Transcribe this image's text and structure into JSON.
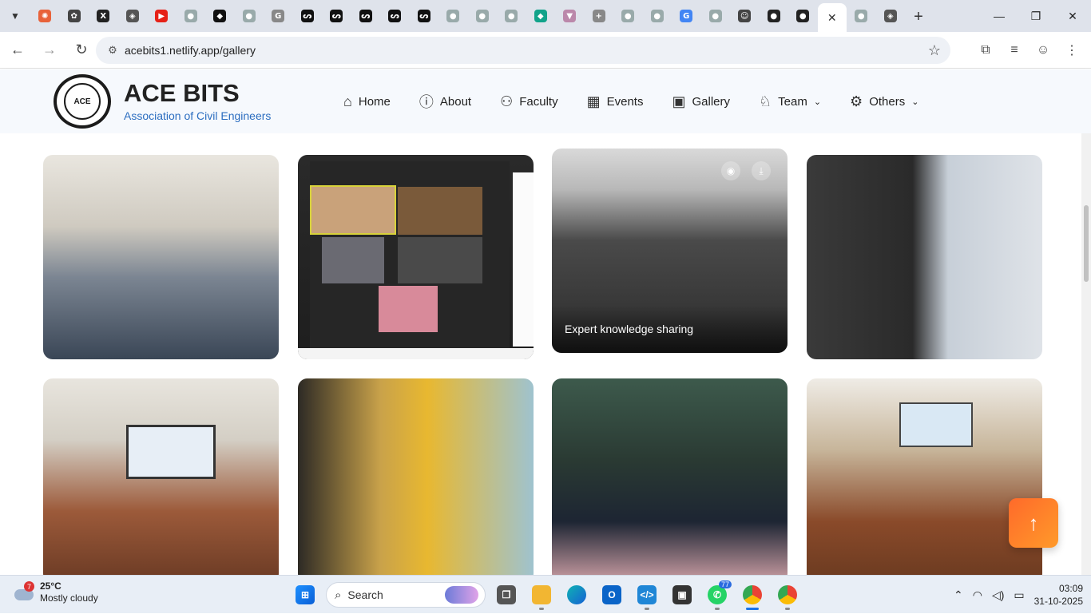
{
  "browser": {
    "tabs": [
      {
        "name": "asterisk",
        "color": "#e8623a",
        "glyph": "✺"
      },
      {
        "name": "openai",
        "color": "#444",
        "glyph": "✿"
      },
      {
        "name": "x",
        "color": "#222",
        "glyph": "X"
      },
      {
        "name": "shield",
        "color": "#555",
        "glyph": "◈"
      },
      {
        "name": "youtube",
        "color": "#e62117",
        "glyph": "▶"
      },
      {
        "name": "globe",
        "color": "#9aa",
        "glyph": "●"
      },
      {
        "name": "leaf",
        "color": "#111",
        "glyph": "◆"
      },
      {
        "name": "globe",
        "color": "#9aa",
        "glyph": "●"
      },
      {
        "name": "google",
        "color": "#888",
        "glyph": "G"
      },
      {
        "name": "snake",
        "color": "#111",
        "glyph": "ᔕ"
      },
      {
        "name": "snake",
        "color": "#111",
        "glyph": "ᔕ"
      },
      {
        "name": "snake",
        "color": "#111",
        "glyph": "ᔕ"
      },
      {
        "name": "snake",
        "color": "#111",
        "glyph": "ᔕ"
      },
      {
        "name": "snake",
        "color": "#111",
        "glyph": "ᔕ"
      },
      {
        "name": "globe",
        "color": "#9aa",
        "glyph": "●"
      },
      {
        "name": "globe",
        "color": "#9aa",
        "glyph": "●"
      },
      {
        "name": "globe",
        "color": "#9aa",
        "glyph": "●"
      },
      {
        "name": "diamond",
        "color": "#12a38a",
        "glyph": "◆"
      },
      {
        "name": "vertex",
        "color": "#b8a",
        "glyph": "▼"
      },
      {
        "name": "crosshair",
        "color": "#888",
        "glyph": "+"
      },
      {
        "name": "globe",
        "color": "#9aa",
        "glyph": "●"
      },
      {
        "name": "globe",
        "color": "#9aa",
        "glyph": "●"
      },
      {
        "name": "google",
        "color": "#4285f4",
        "glyph": "G"
      },
      {
        "name": "globe",
        "color": "#9aa",
        "glyph": "●"
      },
      {
        "name": "person",
        "color": "#444",
        "glyph": "☺"
      },
      {
        "name": "github",
        "color": "#222",
        "glyph": "●"
      },
      {
        "name": "github",
        "color": "#222",
        "glyph": "●"
      }
    ],
    "active_tab_close": "✕",
    "tabs_after": [
      {
        "name": "globe",
        "color": "#9aa",
        "glyph": "●"
      },
      {
        "name": "shield",
        "color": "#555",
        "glyph": "◈"
      }
    ],
    "new_tab": "+",
    "url": "acebits1.netlify.app/gallery"
  },
  "site": {
    "title": "ACE BITS",
    "subtitle": "Association of Civil Engineers",
    "nav": [
      {
        "label": "Home",
        "icon": "home-icon",
        "glyph": "⌂"
      },
      {
        "label": "About",
        "icon": "info-icon",
        "glyph": "ⓘ"
      },
      {
        "label": "Faculty",
        "icon": "users-icon",
        "glyph": "⚇"
      },
      {
        "label": "Events",
        "icon": "calendar-icon",
        "glyph": "▦"
      },
      {
        "label": "Gallery",
        "icon": "image-icon",
        "glyph": "▣"
      },
      {
        "label": "Team",
        "icon": "award-icon",
        "glyph": "♘",
        "dropdown": true
      },
      {
        "label": "Others",
        "icon": "gear-icon",
        "glyph": "⚙",
        "dropdown": true
      }
    ]
  },
  "gallery": {
    "hover_caption": "Expert knowledge sharing",
    "items": [
      {
        "id": "classroom-audience",
        "bg": "linear-gradient(180deg,#e9e6df 0%,#cfcac0 35%,#7b8592 60%,#3a4656 100%)"
      },
      {
        "id": "online-meeting",
        "bg": "linear-gradient(180deg,#2a2a2a 0%,#1e1e1e 100%)"
      },
      {
        "id": "group-photo",
        "bg": "linear-gradient(180deg,#d9d9d9 0%,#b8b8b8 20%,#4a4a4a 45%,#2b2b2b 100%)"
      },
      {
        "id": "speaker-podium",
        "bg": "linear-gradient(90deg,#3a3a3a 0%,#2a2a2a 45%,#c7cfd8 60%,#dfe3e8 100%)"
      },
      {
        "id": "seminar-hall",
        "bg": "linear-gradient(180deg,#e8e5de 0%,#d4cfc5 30%,#9c5a3a 65%,#6a3a24 100%)"
      },
      {
        "id": "award-presentation",
        "bg": "linear-gradient(90deg,#2d2a25 0%,#c9a24a 35%,#e8b830 55%,#9fc3cf 100%)"
      },
      {
        "id": "handshake-stage",
        "bg": "linear-gradient(180deg,#3d5a4c 0%,#2a3a33 40%,#1d2533 70%,#cfa0a6 100%)"
      },
      {
        "id": "guest-felicitation",
        "bg": "linear-gradient(180deg,#efece6 0%,#c7b59a 35%,#8a4a2a 70%,#6a3a20 100%)"
      }
    ]
  },
  "taskbar": {
    "weather_badge": "7",
    "temperature": "25°C",
    "condition": "Mostly cloudy",
    "search_label": "Search",
    "whatsapp_badge": "77",
    "time": "03:09",
    "date": "31-10-2025"
  }
}
